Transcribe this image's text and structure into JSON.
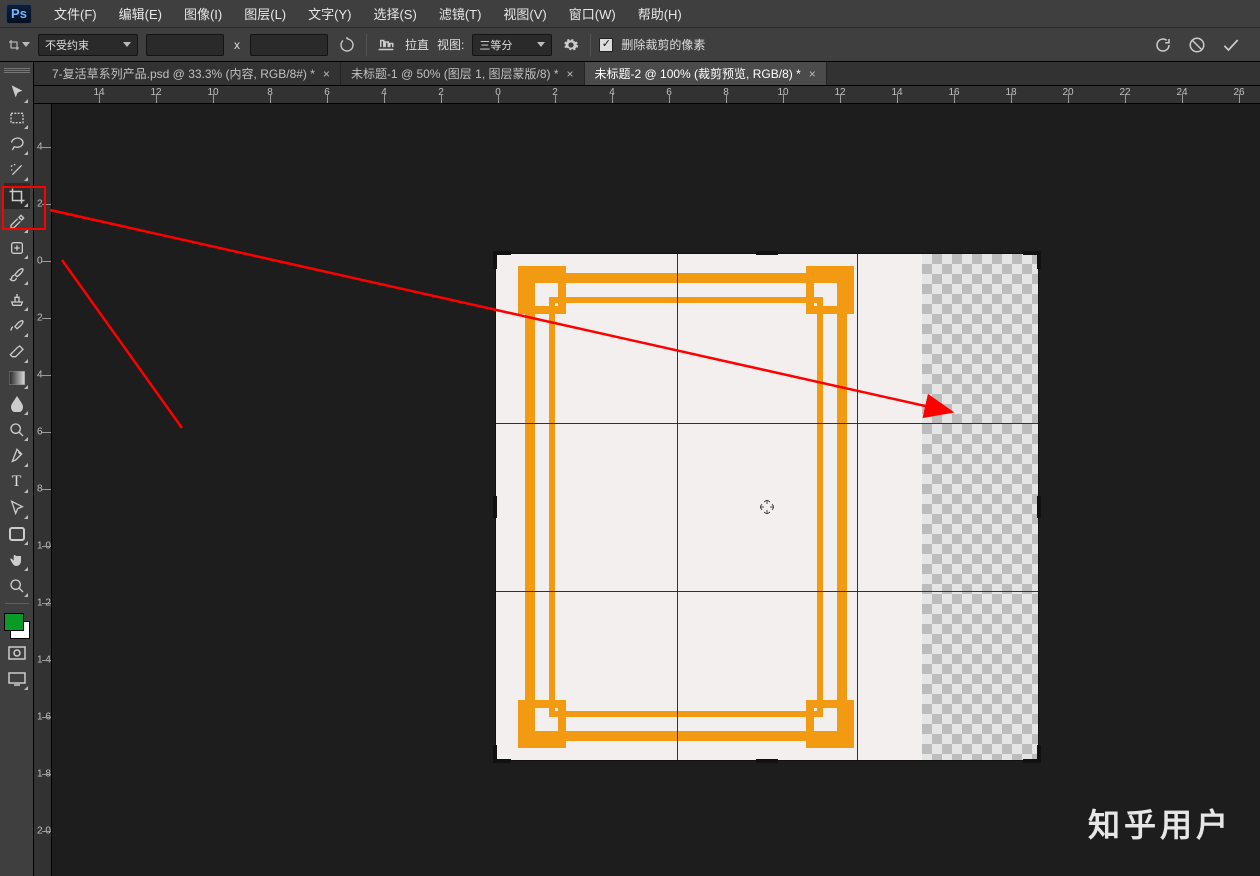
{
  "menubar": {
    "items": [
      "文件(F)",
      "编辑(E)",
      "图像(I)",
      "图层(L)",
      "文字(Y)",
      "选择(S)",
      "滤镜(T)",
      "视图(V)",
      "窗口(W)",
      "帮助(H)"
    ]
  },
  "optionsbar": {
    "ratio": "不受约束",
    "x_separator": "x",
    "straighten_label": "拉直",
    "view_label": "视图:",
    "view_value": "三等分",
    "delete_cropped_label": "删除裁剪的像素"
  },
  "tabs": [
    {
      "label": "7-复活草系列产品.psd @ 33.3% (内容, RGB/8#) *",
      "active": false
    },
    {
      "label": "未标题-1 @ 50% (图层 1, 图层蒙版/8) *",
      "active": false
    },
    {
      "label": "未标题-2 @ 100% (裁剪预览, RGB/8) *",
      "active": true
    }
  ],
  "h_ruler_ticks": [
    {
      "label": "14",
      "neg": true
    },
    {
      "label": "12",
      "neg": true
    },
    {
      "label": "10",
      "neg": true
    },
    {
      "label": "8",
      "neg": true
    },
    {
      "label": "6",
      "neg": true
    },
    {
      "label": "4",
      "neg": true
    },
    {
      "label": "2",
      "neg": true
    },
    {
      "label": "0",
      "neg": false
    },
    {
      "label": "2",
      "neg": false
    },
    {
      "label": "4",
      "neg": false
    },
    {
      "label": "6",
      "neg": false
    },
    {
      "label": "8",
      "neg": false
    },
    {
      "label": "10",
      "neg": false
    },
    {
      "label": "12",
      "neg": false
    },
    {
      "label": "14",
      "neg": false
    },
    {
      "label": "16",
      "neg": false
    },
    {
      "label": "18",
      "neg": false
    },
    {
      "label": "20",
      "neg": false
    },
    {
      "label": "22",
      "neg": false
    },
    {
      "label": "24",
      "neg": false
    },
    {
      "label": "26",
      "neg": false
    }
  ],
  "v_ruler_ticks": [
    "4",
    "2",
    "0",
    "2",
    "4",
    "6",
    "8",
    "1  0",
    "1  2",
    "1  4",
    "1  6",
    "1  8",
    "2  0"
  ],
  "watermark": "知乎用户",
  "toolbox": {
    "tools": [
      {
        "name": "move-tool",
        "glyph": "↖"
      },
      {
        "name": "marquee-tool",
        "glyph": "▭"
      },
      {
        "name": "lasso-tool",
        "glyph": "∿"
      },
      {
        "name": "magic-wand-tool",
        "glyph": "✧"
      },
      {
        "name": "crop-tool",
        "glyph": "⧈",
        "selected": true
      },
      {
        "name": "eyedropper-tool",
        "glyph": "✎"
      },
      {
        "name": "healing-brush-tool",
        "glyph": "✚"
      },
      {
        "name": "brush-tool",
        "glyph": "🖌"
      },
      {
        "name": "clone-stamp-tool",
        "glyph": "⎍"
      },
      {
        "name": "history-brush-tool",
        "glyph": "↺"
      },
      {
        "name": "eraser-tool",
        "glyph": "▱"
      },
      {
        "name": "gradient-tool",
        "glyph": "▮"
      },
      {
        "name": "blur-tool",
        "glyph": "●"
      },
      {
        "name": "dodge-tool",
        "glyph": "◐"
      },
      {
        "name": "pen-tool",
        "glyph": "✒"
      },
      {
        "name": "type-tool",
        "glyph": "T"
      },
      {
        "name": "path-select-tool",
        "glyph": "⬈"
      },
      {
        "name": "shape-tool",
        "glyph": "▭"
      },
      {
        "name": "hand-tool",
        "glyph": "✋"
      },
      {
        "name": "zoom-tool",
        "glyph": "🔍"
      }
    ]
  }
}
